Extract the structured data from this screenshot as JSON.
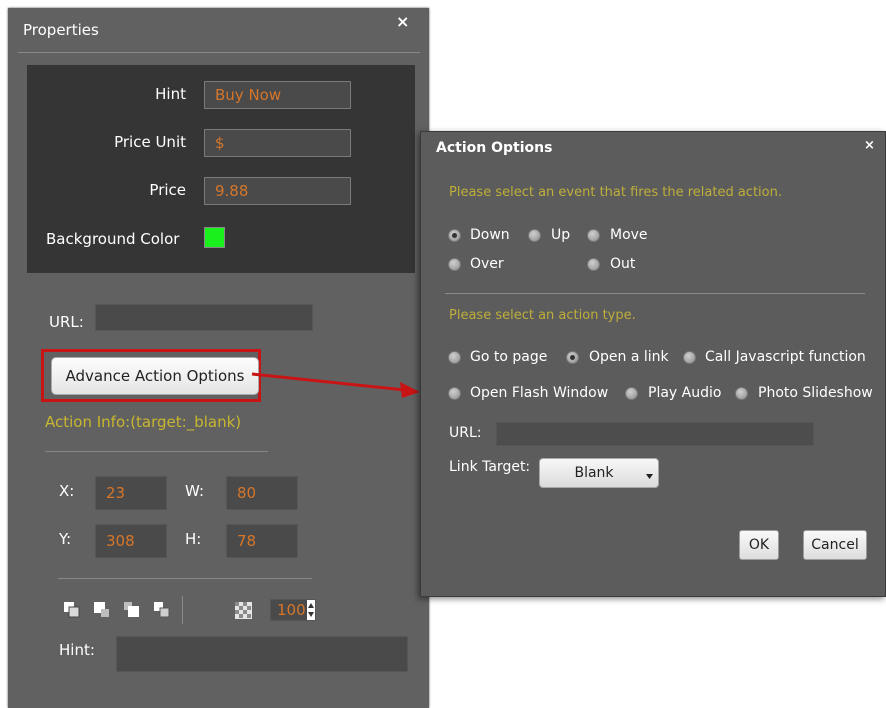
{
  "properties": {
    "title": "Properties",
    "close": "×",
    "hint_label": "Hint",
    "hint_value": "Buy Now",
    "price_unit_label": "Price Unit",
    "price_unit_value": "$",
    "price_label": "Price",
    "price_value": "9.88",
    "bg_color_label": "Background Color",
    "bg_color": "#19f01c",
    "url_label": "URL:",
    "url_value": "",
    "advance_button": "Advance Action Options",
    "action_info": "Action Info:(target:_blank)",
    "x_label": "X:",
    "x_value": "23",
    "w_label": "W:",
    "w_value": "80",
    "y_label": "Y:",
    "y_value": "308",
    "h_label": "H:",
    "h_value": "78",
    "opacity_value": "100",
    "bottom_hint_label": "Hint:",
    "bottom_hint_value": "",
    "accent_text_color": "#d5762a",
    "highlight_color": "#c81414"
  },
  "toolbar": {
    "icons": [
      "bring-to-front-icon",
      "send-to-back-icon",
      "bring-forward-icon",
      "send-backward-icon",
      "opacity-icon"
    ]
  },
  "action_options": {
    "title": "Action Options",
    "close": "×",
    "event_prompt": "Please select an event that fires the related action.",
    "events": [
      {
        "label": "Down",
        "selected": true
      },
      {
        "label": "Up",
        "selected": false
      },
      {
        "label": "Move",
        "selected": false
      },
      {
        "label": "Over",
        "selected": false
      },
      {
        "label": "Out",
        "selected": false
      }
    ],
    "action_prompt": "Please select an action type.",
    "actions": [
      {
        "label": "Go to page",
        "selected": false
      },
      {
        "label": "Open a link",
        "selected": true
      },
      {
        "label": "Call Javascript function",
        "selected": false
      },
      {
        "label": "Open Flash Window",
        "selected": false
      },
      {
        "label": "Play Audio",
        "selected": false
      },
      {
        "label": "Photo Slideshow",
        "selected": false
      }
    ],
    "url_label": "URL:",
    "url_value": "",
    "link_target_label": "Link Target:",
    "link_target_value": "Blank",
    "ok_button": "OK",
    "cancel_button": "Cancel"
  }
}
